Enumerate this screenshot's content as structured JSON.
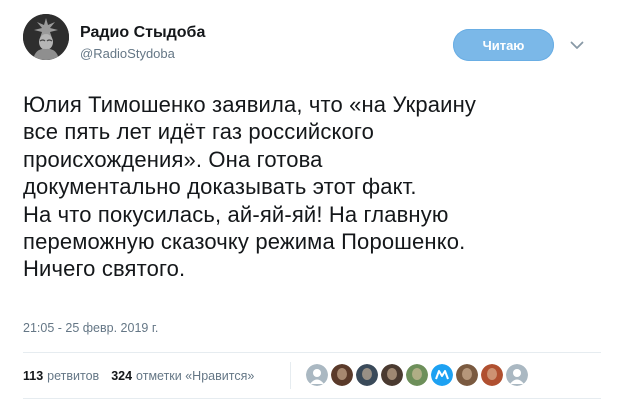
{
  "account": {
    "name": "Радио Стыдоба",
    "handle": "@RadioStydoba"
  },
  "follow_button": {
    "label": "Читаю"
  },
  "caret_icon": "chevron-down-icon",
  "tweet": {
    "lines": [
      "Юлия Тимошенко заявила, что «на Украину",
      "все пять лет идёт газ российского",
      "происхождения». Она готова",
      "документально доказывать этот факт.",
      "На что покусилась, ай-яй-яй! На главную",
      "переможную сказочку режима Порошенко.",
      "Ничего святого."
    ],
    "timestamp": "21:05 - 25 февр. 2019 г."
  },
  "stats": {
    "retweets_count": "113",
    "retweets_label": "ретвитов",
    "likes_count": "324",
    "likes_label": "отметки «Нравится»"
  },
  "likers": [
    {
      "name": "liker-default-avatar-1",
      "color": "#aab8c2"
    },
    {
      "name": "liker-avatar-2",
      "color": "#5a3a2a"
    },
    {
      "name": "liker-avatar-3",
      "color": "#3a4a5a"
    },
    {
      "name": "liker-avatar-4",
      "color": "#4a3a30"
    },
    {
      "name": "liker-avatar-5",
      "color": "#6d8f5a"
    },
    {
      "name": "liker-avatar-6",
      "color": "#1da1f2"
    },
    {
      "name": "liker-avatar-7",
      "color": "#7a5a40"
    },
    {
      "name": "liker-avatar-8",
      "color": "#b05030"
    },
    {
      "name": "liker-default-avatar-9",
      "color": "#aab8c2"
    }
  ],
  "colors": {
    "accent": "#1da1f2",
    "follow_button_bg": "#7bb8e8",
    "secondary_text": "#657786",
    "divider": "#e6ecf0"
  }
}
